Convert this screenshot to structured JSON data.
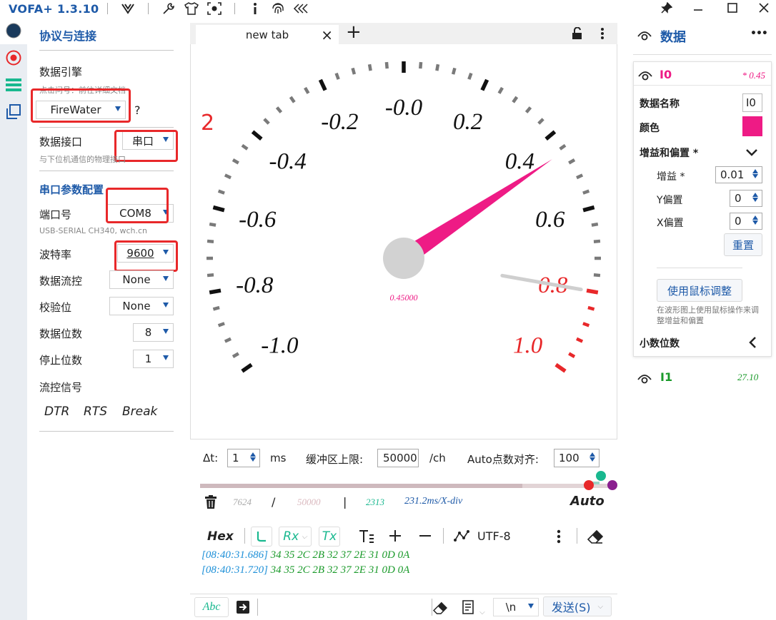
{
  "title": "VOFA+ 1.3.10",
  "config": {
    "section1_title": "协议与连接",
    "engine_label": "数据引擎",
    "engine_hint": "点击问号：前往详细文档",
    "engine_value": "FireWater",
    "help_mark": "?",
    "interface_label": "数据接口",
    "interface_value": "串口",
    "interface_hint": "与下位机通信的物理接口",
    "section2_title": "串口参数配置",
    "port_label": "端口号",
    "port_value": "COM8",
    "port_hint": "USB-SERIAL CH340, wch.cn",
    "baud_label": "波特率",
    "baud_value": "9600",
    "flow_label": "数据流控",
    "flow_value": "None",
    "parity_label": "校验位",
    "parity_value": "None",
    "databits_label": "数据位数",
    "databits_value": "8",
    "stopbits_label": "停止位数",
    "stopbits_value": "1",
    "flowsig_label": "流控信号",
    "dtr": "DTR",
    "rts": "RTS",
    "brk": "Break"
  },
  "tab": {
    "label": "new tab",
    "close": "×",
    "add": "+"
  },
  "gauge": {
    "channel_index": "2",
    "value": 0.45,
    "value_text": "0.45000",
    "min": -1.0,
    "max": 1.0,
    "labels": [
      "-1.0",
      "-0.8",
      "-0.6",
      "-0.4",
      "-0.2",
      "-0.0",
      "0.2",
      "0.4",
      "0.6",
      "0.8",
      "1.0"
    ],
    "red_from": 0.8,
    "needle_color": "#ee1b85",
    "second_needle_value": 0.8
  },
  "controls": {
    "dt_label": "Δt:",
    "dt_value": "1",
    "dt_unit": "ms",
    "buffer_label": "缓冲区上限:",
    "buffer_value": "50000",
    "buffer_unit": "/ch",
    "auto_label": "Auto点数对齐:",
    "auto_value": "100"
  },
  "stats": {
    "count": "7624",
    "slash": "/",
    "limit": "50000",
    "pipe": "|",
    "points": "2313",
    "div": "231.2ms/X-div",
    "auto": "Auto",
    "progress": 0.78
  },
  "toolbar": {
    "hex": "Hex",
    "rx": "Rx",
    "tx": "Tx",
    "encoding": "UTF-8"
  },
  "log": {
    "lines": [
      {
        "time": "[08:40:31.686]",
        "data": "34 35 2C 2B 32 37 2E 31 0D 0A"
      },
      {
        "time": "[08:40:31.720]",
        "data": "34 35 2C 2B 32 37 2E 31 0D 0A"
      }
    ]
  },
  "bottom": {
    "abc": "Abc",
    "newline": "\\n",
    "send": "发送(S)"
  },
  "right": {
    "title": "数据",
    "more": "•••",
    "ch0_name": "I0",
    "ch0_value": "* 0.45",
    "name_label": "数据名称",
    "name_value": "I0",
    "color_label": "颜色",
    "color_value": "#ee1b85",
    "gain_section": "增益和偏置 *",
    "gain_label": "增益 *",
    "gain_value": "0.01",
    "yoff_label": "Y偏置",
    "yoff_value": "0",
    "xoff_label": "X偏置",
    "xoff_value": "0",
    "reset": "重置",
    "mouse_adjust": "使用鼠标调整",
    "mouse_hint": "在波形图上使用鼠标操作来调整增益和偏置",
    "decimals_label": "小数位数",
    "ch1_name": "I1",
    "ch1_value": "27.10"
  }
}
